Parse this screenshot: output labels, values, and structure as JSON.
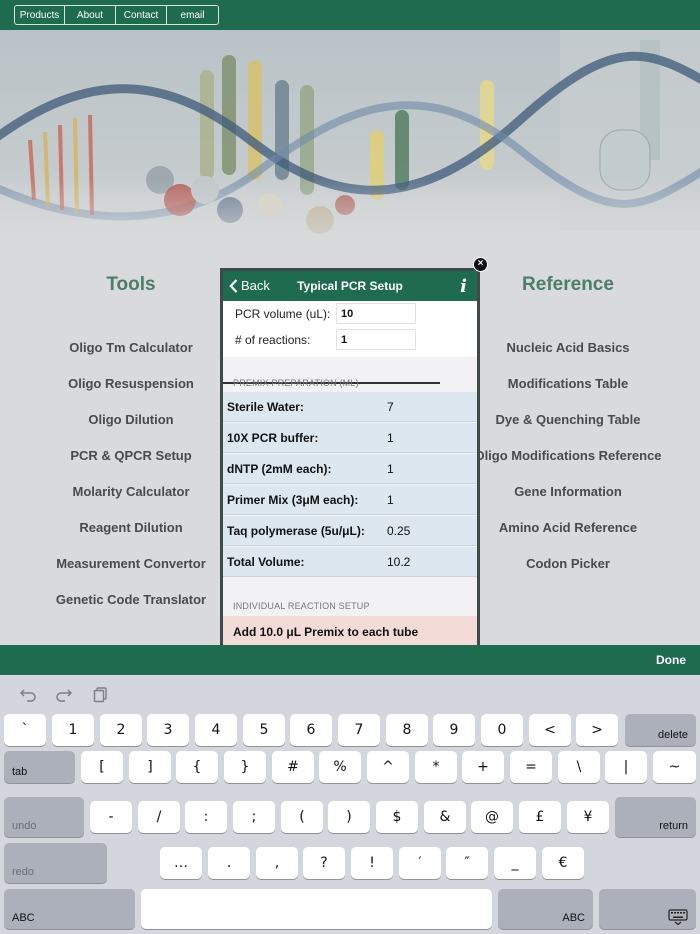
{
  "nav": {
    "items": [
      "Products",
      "About",
      "Contact",
      "email"
    ]
  },
  "tools": {
    "heading": "Tools",
    "items": [
      "Oligo Tm Calculator",
      "Oligo Resuspension",
      "Oligo Dilution",
      "PCR & QPCR Setup",
      "Molarity Calculator",
      "Reagent Dilution",
      "Measurement Convertor",
      "Genetic Code Translator"
    ]
  },
  "reference": {
    "heading": "Reference",
    "items": [
      "Nucleic Acid Basics",
      "Modifications Table",
      "Dye & Quenching Table",
      "Oligo Modifications Reference",
      "Gene Information",
      "Amino Acid Reference",
      "Codon Picker"
    ]
  },
  "popup": {
    "back_label": "Back",
    "title": "Typical PCR Setup",
    "info_label": "i",
    "close_label": "×",
    "inputs": [
      {
        "label": "PCR volume (uL):",
        "value": "10"
      },
      {
        "label": "# of reactions:",
        "value": "1"
      }
    ],
    "premix_label": "PREMIX PREPARATION (ML)",
    "premix_rows": [
      {
        "label": "Sterile Water:",
        "value": "7"
      },
      {
        "label": "10X PCR buffer:",
        "value": "1"
      },
      {
        "label": "dNTP (2mM each):",
        "value": "1"
      },
      {
        "label": "Primer Mix (3μM each):",
        "value": "1"
      },
      {
        "label": "Taq polymerase (5u/μL):",
        "value": "0.25"
      },
      {
        "label": "Total Volume:",
        "value": "10.2"
      }
    ],
    "individual_label": "INDIVIDUAL REACTION SETUP",
    "result": "Add 10.0 μL Premix to each tube"
  },
  "toolbar": {
    "done_label": "Done"
  },
  "keyboard": {
    "row1": [
      "`",
      "1",
      "2",
      "3",
      "4",
      "5",
      "6",
      "7",
      "8",
      "9",
      "0",
      "<",
      ">"
    ],
    "row1_mod": "delete",
    "row2_mod": "tab",
    "row2": [
      "[",
      "]",
      "{",
      "}",
      "#",
      "%",
      "^",
      "*",
      "+",
      "=",
      "\\",
      "|",
      "~"
    ],
    "row3_mod_left": "undo",
    "row3": [
      "-",
      "/",
      ":",
      ";",
      "(",
      ")",
      "$",
      "&",
      "@",
      "£",
      "¥"
    ],
    "row3_mod_right": "return",
    "row4_mod": "redo",
    "row4": [
      "…",
      ".",
      ",",
      "?",
      "!",
      "′",
      "″",
      "_",
      "€"
    ],
    "abc_left": "ABC",
    "abc_right": "ABC"
  }
}
